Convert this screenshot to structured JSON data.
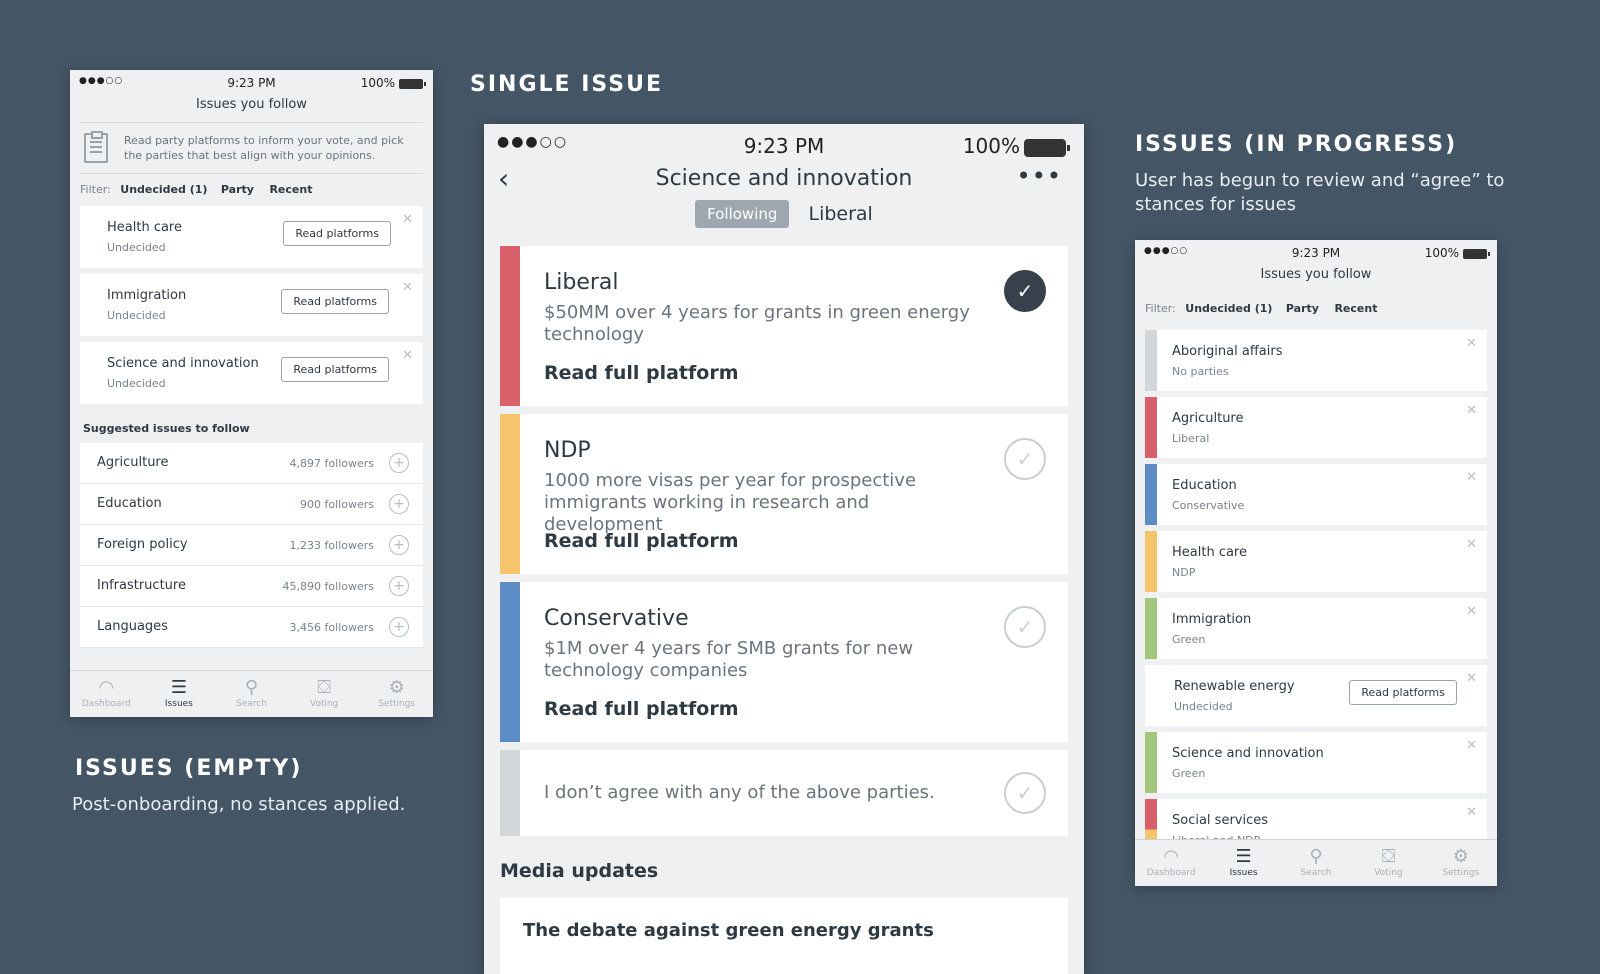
{
  "captions": {
    "empty_title": "ISSUES (EMPTY)",
    "empty_sub": "Post-onboarding, no stances applied.",
    "single_title": "SINGLE ISSUE",
    "progress_title": "ISSUES (IN PROGRESS)",
    "progress_sub_1": "User has begun to review and “agree” to",
    "progress_sub_2": "stances for issues"
  },
  "status": {
    "dots": "●●●○○",
    "time": "9:23 PM",
    "battery": "100%"
  },
  "tabs": [
    {
      "label": "Dashboard",
      "icon": "◠"
    },
    {
      "label": "Issues",
      "icon": "☰"
    },
    {
      "label": "Search",
      "icon": "⚲"
    },
    {
      "label": "Voting",
      "icon": "⛋"
    },
    {
      "label": "Settings",
      "icon": "⚙"
    }
  ],
  "filter": {
    "label": "Filter:",
    "undecided": "Undecided (1)",
    "party": "Party",
    "recent": "Recent"
  },
  "empty_screen": {
    "title": "Issues you follow",
    "intro": "Read party platforms to inform your vote, and pick the parties that best align with your opinions.",
    "issues": [
      {
        "name": "Health care",
        "status": "Undecided",
        "button": "Read platforms"
      },
      {
        "name": "Immigration",
        "status": "Undecided",
        "button": "Read platforms"
      },
      {
        "name": "Science and innovation",
        "status": "Undecided",
        "button": "Read platforms"
      }
    ],
    "suggested_title": "Suggested issues to follow",
    "suggested": [
      {
        "name": "Agriculture",
        "followers": "4,897 followers"
      },
      {
        "name": "Education",
        "followers": "900 followers"
      },
      {
        "name": "Foreign policy",
        "followers": "1,233 followers"
      },
      {
        "name": "Infrastructure",
        "followers": "45,890 followers"
      },
      {
        "name": "Languages",
        "followers": "3,456 followers"
      }
    ]
  },
  "single_screen": {
    "title": "Science and innovation",
    "following": "Following",
    "party": "Liberal",
    "platforms": [
      {
        "party": "Liberal",
        "desc": "$50MM over 4 years for grants in green energy technology",
        "link": "Read full platform",
        "color": "#d9606b",
        "checked": true
      },
      {
        "party": "NDP",
        "desc": "1000 more visas per year for prospective immigrants working in research and development",
        "link": "Read full platform",
        "color": "#f5c46c",
        "checked": false
      },
      {
        "party": "Conservative",
        "desc": "$1M over 4 years for SMB grants for new technology companies",
        "link": "Read full platform",
        "color": "#5d8bc4",
        "checked": false
      }
    ],
    "none_option": "I don’t agree with any of the above parties.",
    "media_title": "Media updates",
    "media_item": "The debate against green energy grants"
  },
  "progress_screen": {
    "title": "Issues you follow",
    "issues": [
      {
        "name": "Aboriginal affairs",
        "status": "No parties",
        "color": "#d3d6d9"
      },
      {
        "name": "Agriculture",
        "status": "Liberal",
        "color": "#d9606b"
      },
      {
        "name": "Education",
        "status": "Conservative",
        "color": "#5d8bc4"
      },
      {
        "name": "Health care",
        "status": "NDP",
        "color": "#f5c46c"
      },
      {
        "name": "Immigration",
        "status": "Green",
        "color": "#a4c57c"
      },
      {
        "name": "Renewable energy",
        "status": "Undecided",
        "color": "",
        "button": "Read platforms"
      },
      {
        "name": "Science and innovation",
        "status": "Green",
        "color": "#a4c57c"
      },
      {
        "name": "Social services",
        "status": "Liberal and NDP",
        "color": "#d9606b"
      }
    ]
  },
  "colors": {
    "background": "#445565",
    "liberal": "#d9606b",
    "ndp": "#f5c46c",
    "conservative": "#5d8bc4",
    "green": "#a4c57c"
  }
}
